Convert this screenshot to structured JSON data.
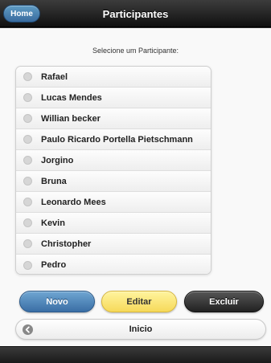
{
  "header": {
    "home_label": "Home",
    "title": "Participantes"
  },
  "prompt": "Selecione um Participante:",
  "participants": [
    {
      "name": "Rafael"
    },
    {
      "name": "Lucas Mendes"
    },
    {
      "name": "Willian becker"
    },
    {
      "name": "Paulo Ricardo Portella Pietschmann"
    },
    {
      "name": "Jorgino"
    },
    {
      "name": "Bruna"
    },
    {
      "name": "Leonardo Mees"
    },
    {
      "name": "Kevin"
    },
    {
      "name": "Christopher"
    },
    {
      "name": "Pedro"
    }
  ],
  "actions": {
    "novo_label": "Novo",
    "editar_label": "Editar",
    "excluir_label": "Excluir"
  },
  "inicio": {
    "label": "Inicio",
    "icon": "arrow-left-icon"
  },
  "colors": {
    "header_bg": "#1f1f1f",
    "novo": "#3a6ea5",
    "editar": "#f6d95a",
    "excluir": "#2a2a2a"
  }
}
